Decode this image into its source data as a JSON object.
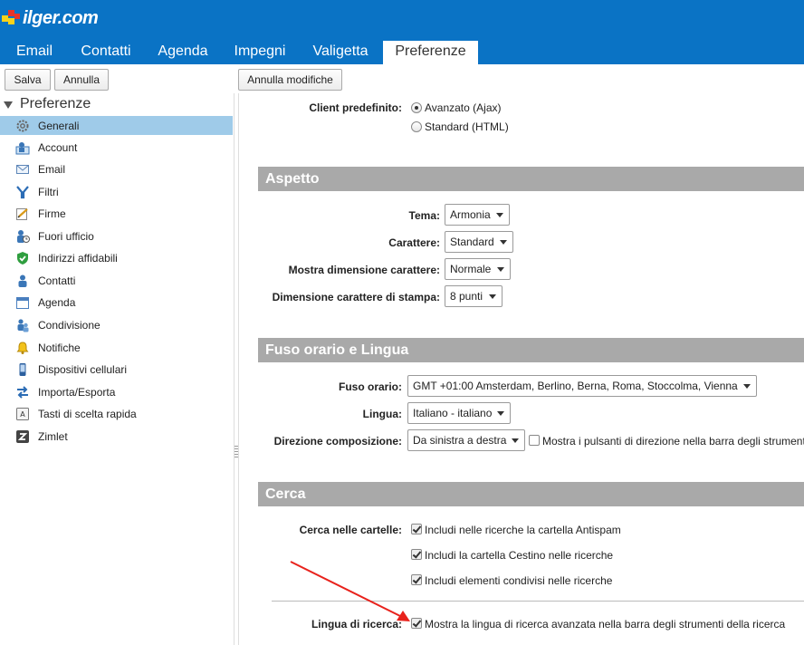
{
  "brand": {
    "logo_text": "ilger.com"
  },
  "app_tabs": [
    {
      "label": "Email"
    },
    {
      "label": "Contatti"
    },
    {
      "label": "Agenda"
    },
    {
      "label": "Impegni"
    },
    {
      "label": "Valigetta"
    },
    {
      "label": "Preferenze"
    }
  ],
  "toolbar": {
    "save_label": "Salva",
    "cancel_label": "Annulla",
    "undo_changes_label": "Annulla modifiche"
  },
  "sidebar": {
    "header": "Preferenze",
    "items": [
      {
        "label": "Generali",
        "icon": "gear-icon"
      },
      {
        "label": "Account",
        "icon": "account-icon"
      },
      {
        "label": "Email",
        "icon": "envelope-icon"
      },
      {
        "label": "Filtri",
        "icon": "filter-icon"
      },
      {
        "label": "Firme",
        "icon": "signature-icon"
      },
      {
        "label": "Fuori ufficio",
        "icon": "out-of-office-icon"
      },
      {
        "label": "Indirizzi affidabili",
        "icon": "shield-check-icon"
      },
      {
        "label": "Contatti",
        "icon": "contact-icon"
      },
      {
        "label": "Agenda",
        "icon": "calendar-icon"
      },
      {
        "label": "Condivisione",
        "icon": "sharing-icon"
      },
      {
        "label": "Notifiche",
        "icon": "bell-icon"
      },
      {
        "label": "Dispositivi cellulari",
        "icon": "mobile-icon"
      },
      {
        "label": "Importa/Esporta",
        "icon": "import-export-icon"
      },
      {
        "label": "Tasti di scelta rapida",
        "icon": "keyboard-shortcut-icon"
      },
      {
        "label": "Zimlet",
        "icon": "zimlet-icon"
      }
    ]
  },
  "client": {
    "label": "Client predefinito:",
    "options": [
      {
        "label": "Avanzato (Ajax)"
      },
      {
        "label": "Standard (HTML)"
      }
    ]
  },
  "aspetto": {
    "title": "Aspetto",
    "tema_label": "Tema:",
    "tema_value": "Armonia",
    "carattere_label": "Carattere:",
    "carattere_value": "Standard",
    "mostra_dim_label": "Mostra dimensione carattere:",
    "mostra_dim_value": "Normale",
    "dim_stampa_label": "Dimensione carattere di stampa:",
    "dim_stampa_value": "8 punti"
  },
  "fuso": {
    "title": "Fuso orario e Lingua",
    "fuso_label": "Fuso orario:",
    "fuso_value": "GMT +01:00 Amsterdam, Berlino, Berna, Roma, Stoccolma, Vienna",
    "lingua_label": "Lingua:",
    "lingua_value": "Italiano - italiano",
    "direzione_label": "Direzione composizione:",
    "direzione_value": "Da sinistra a destra",
    "direzione_checkbox": "Mostra i pulsanti di direzione nella barra degli strumenti"
  },
  "cerca": {
    "title": "Cerca",
    "cartelle_label": "Cerca nelle cartelle:",
    "options": [
      {
        "label": "Includi nelle ricerche la cartella Antispam"
      },
      {
        "label": "Includi la cartella Cestino nelle ricerche"
      },
      {
        "label": "Includi elementi condivisi nelle ricerche"
      }
    ],
    "lingua_label": "Lingua di ricerca:",
    "lingua_option": "Mostra la lingua di ricerca avanzata nella barra degli strumenti della ricerca"
  },
  "colors": {
    "banner": "#0a73c5",
    "selected": "#9fcbe9",
    "section": "#a9a9a9",
    "arrow": "#e8221c"
  }
}
